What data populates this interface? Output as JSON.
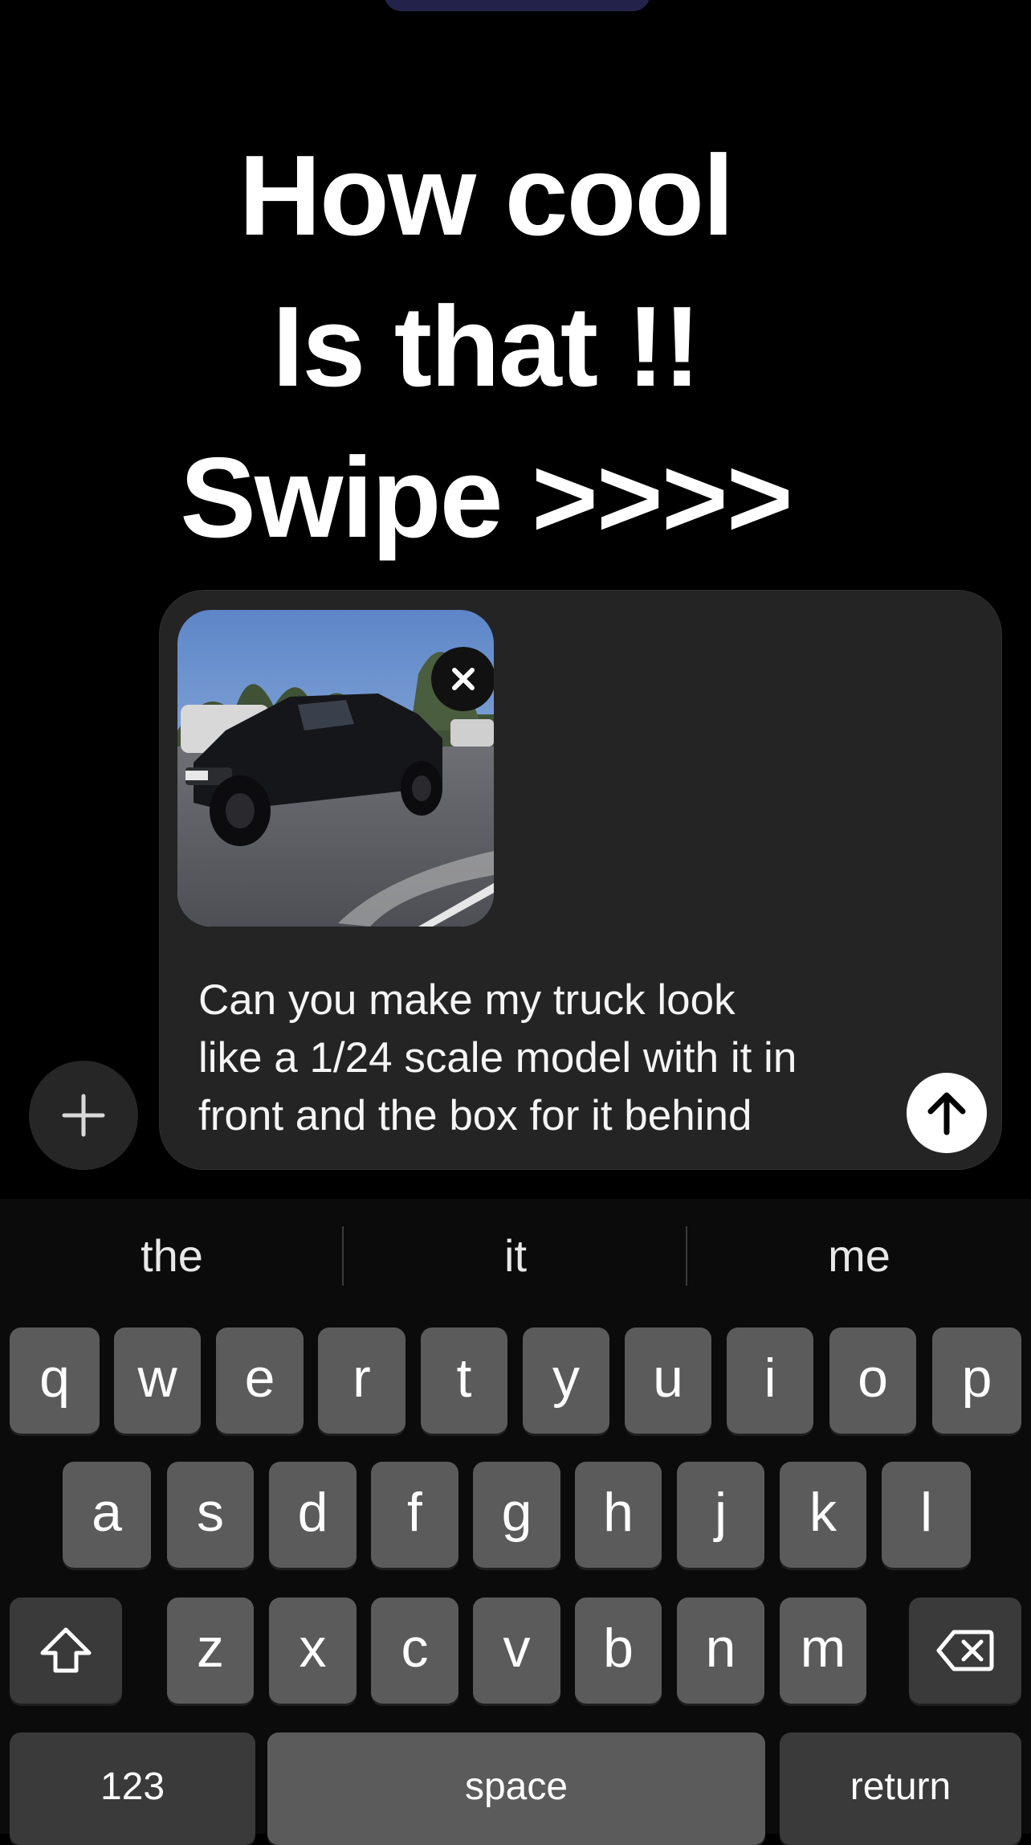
{
  "overlay": {
    "line1": "How cool",
    "line2": "Is that !!",
    "line3": "Swipe >>>>"
  },
  "composer": {
    "message": "Can you make my truck look\nlike a 1/24 scale model with it in\nfront and the box for it behind",
    "attachment_icon": "photo-thumbnail",
    "remove_icon": "close-icon",
    "send_icon": "arrow-up-icon",
    "add_icon": "plus-icon"
  },
  "keyboard": {
    "suggestions": [
      "the",
      "it",
      "me"
    ],
    "row1": [
      "q",
      "w",
      "e",
      "r",
      "t",
      "y",
      "u",
      "i",
      "o",
      "p"
    ],
    "row2": [
      "a",
      "s",
      "d",
      "f",
      "g",
      "h",
      "j",
      "k",
      "l"
    ],
    "row3": [
      "z",
      "x",
      "c",
      "v",
      "b",
      "n",
      "m"
    ],
    "shift_icon": "shift-icon",
    "delete_icon": "backspace-icon",
    "numbers_label": "123",
    "space_label": "space",
    "return_label": "return"
  }
}
